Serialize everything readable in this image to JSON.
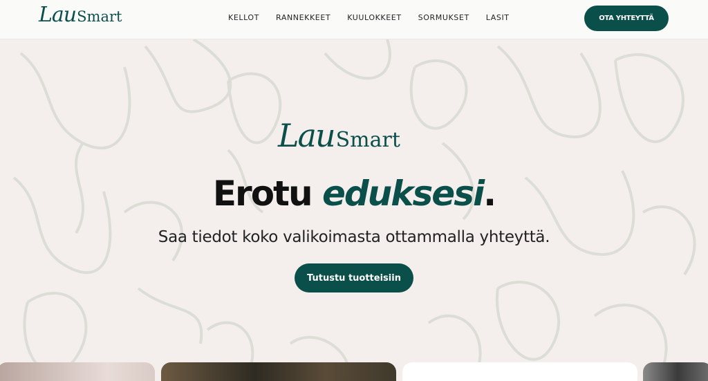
{
  "brand": {
    "logo_script": "Lau",
    "logo_serif": "Smart"
  },
  "nav": {
    "items": [
      "KELLOT",
      "RANNEKKEET",
      "KUULOKKEET",
      "SORMUKSET",
      "LASIT"
    ]
  },
  "header": {
    "cta_label": "OTA YHTEYTTÄ"
  },
  "hero": {
    "headline_main": "Erotu ",
    "headline_accent": "eduksesi",
    "headline_end": ".",
    "subtitle": "Saa tiedot koko valikoimasta ottammalla yhteyttä.",
    "cta_label": "Tutustu tuotteisiin"
  },
  "colors": {
    "accent": "#0b4f4a",
    "background": "#f4efec",
    "header_bg": "#fafaf9"
  }
}
